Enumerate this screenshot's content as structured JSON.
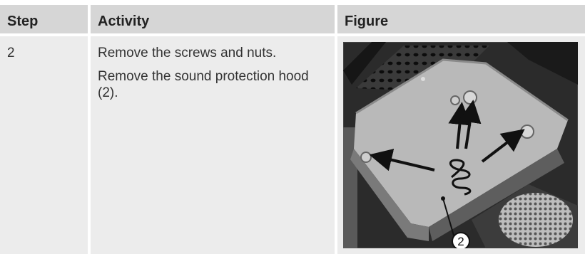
{
  "header": {
    "step": "Step",
    "activity": "Activity",
    "figure": "Figure"
  },
  "row": {
    "step": "2",
    "activity": [
      "Remove the screws and nuts.",
      "Remove the sound protection hood (2)."
    ],
    "figure_callout": "2"
  }
}
